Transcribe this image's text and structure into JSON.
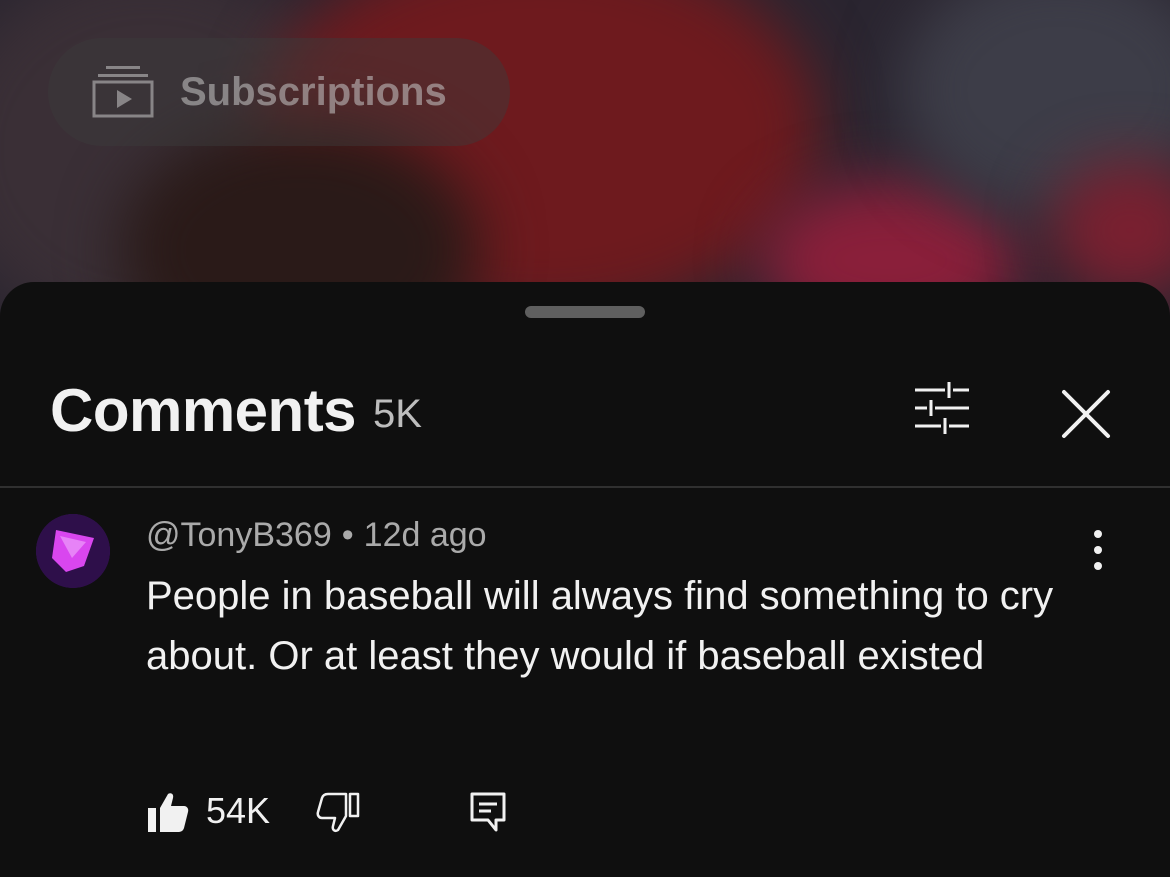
{
  "background": {
    "subscriptions_label": "Subscriptions",
    "subscriptions_icon": "subscriptions-icon"
  },
  "comments_sheet": {
    "title": "Comments",
    "count": "5K",
    "filter_icon": "sliders-icon",
    "close_icon": "close-icon"
  },
  "comment": {
    "author": "@TonyB369",
    "separator": "•",
    "time": "12d ago",
    "text": "People in baseball will always find something to cry about. Or at least they would if baseball existed",
    "like_count": "54K",
    "icons": {
      "like": "thumbs-up-icon",
      "dislike": "thumbs-down-icon",
      "reply": "reply-icon",
      "more": "more-vert-icon"
    }
  },
  "colors": {
    "sheet_background": "#0f0f0f",
    "primary_text": "#f1f1f1",
    "secondary_text": "#aaaaaa",
    "avatar_accent": "#d946ef"
  }
}
